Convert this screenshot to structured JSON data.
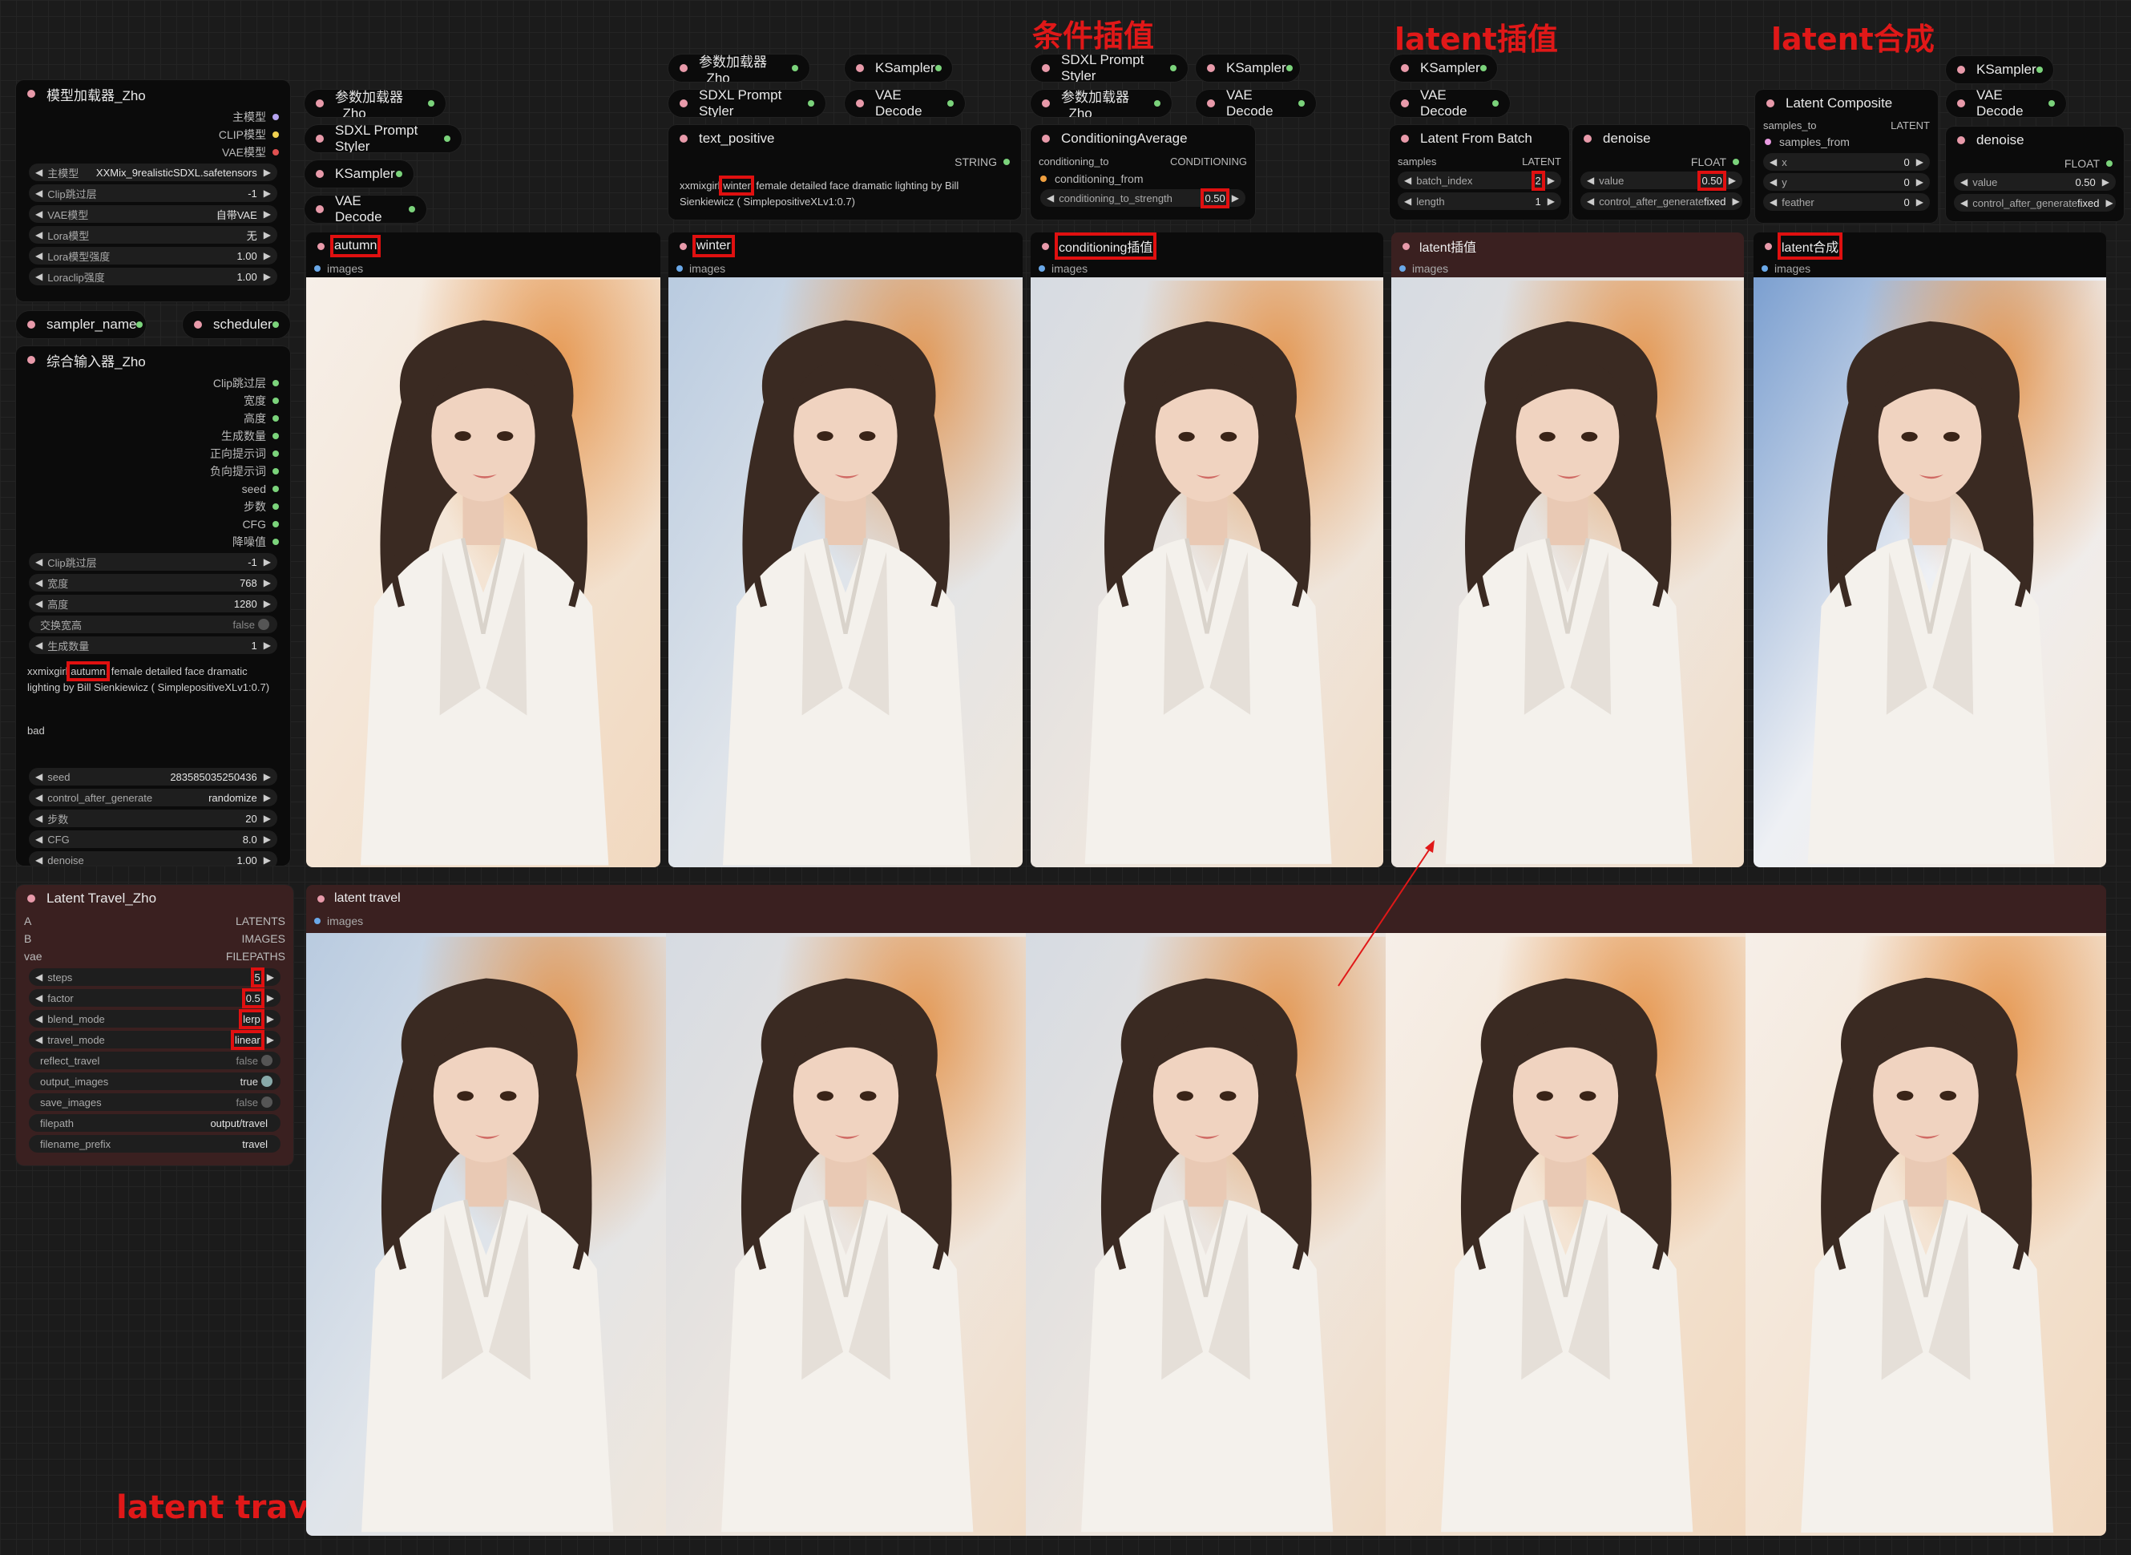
{
  "annotations": {
    "cond_interp": "条件插值",
    "latent_interp": "latent插值",
    "latent_comp": "latent合成",
    "latent_travel": "latent travel"
  },
  "colors": {
    "accent_red": "#e01818",
    "bg": "#1b1b1b",
    "node_bg": "#0b0b0b",
    "brown_node": "#3a2020"
  },
  "model_loader": {
    "title": "模型加载器_Zho",
    "outputs": [
      "主模型",
      "CLIP模型",
      "VAE模型"
    ],
    "widgets": [
      {
        "label": "主模型",
        "value": "XXMix_9realisticSDXL.safetensors"
      },
      {
        "label": "Clip跳过层",
        "value": "-1"
      },
      {
        "label": "VAE模型",
        "value": "自带VAE"
      },
      {
        "label": "Lora模型",
        "value": "无"
      },
      {
        "label": "Lora模型强度",
        "value": "1.00"
      },
      {
        "label": "Loraclip强度",
        "value": "1.00"
      }
    ]
  },
  "sampler_name": "sampler_name",
  "scheduler": "scheduler",
  "combo_input": {
    "title": "综合输入器_Zho",
    "outputs": [
      "Clip跳过层",
      "宽度",
      "高度",
      "生成数量",
      "正向提示词",
      "负向提示词",
      "seed",
      "步数",
      "CFG",
      "降噪值"
    ],
    "widgets": [
      {
        "label": "Clip跳过层",
        "value": "-1"
      },
      {
        "label": "宽度",
        "value": "768"
      },
      {
        "label": "高度",
        "value": "1280"
      },
      {
        "label": "交换宽高",
        "value": "false"
      },
      {
        "label": "生成数量",
        "value": "1"
      }
    ],
    "prompt_pre": "xxmixgirl",
    "prompt_key": "autumn",
    "prompt_post": ", female detailed face dramatic lighting by Bill Sienkiewicz ( SimplepositiveXLv1:0.7)",
    "negative": "bad",
    "widgets2": [
      {
        "label": "seed",
        "value": "283585035250436"
      },
      {
        "label": "control_after_generate",
        "value": "randomize"
      },
      {
        "label": "步数",
        "value": "20"
      },
      {
        "label": "CFG",
        "value": "8.0"
      },
      {
        "label": "denoise",
        "value": "1.00"
      }
    ]
  },
  "latent_travel_node": {
    "title": "Latent Travel_Zho",
    "inputs": [
      "A",
      "B",
      "vae"
    ],
    "outputs": [
      "LATENTS",
      "IMAGES",
      "FILEPATHS"
    ],
    "widgets": [
      {
        "label": "steps",
        "value": "5"
      },
      {
        "label": "factor",
        "value": "0.5"
      },
      {
        "label": "blend_mode",
        "value": "lerp"
      },
      {
        "label": "travel_mode",
        "value": "linear"
      },
      {
        "label": "reflect_travel",
        "value": "false"
      },
      {
        "label": "output_images",
        "value": "true"
      },
      {
        "label": "save_images",
        "value": "false"
      },
      {
        "label": "filepath",
        "value": "output/travel"
      },
      {
        "label": "filename_prefix",
        "value": "travel"
      }
    ]
  },
  "col1": {
    "param_loader": "参数加载器_Zho",
    "styler": "SDXL Prompt Styler",
    "ksampler": "KSampler",
    "vae_decode": "VAE Decode"
  },
  "col2": {
    "param_loader": "参数加载器_Zho",
    "styler": "SDXL Prompt Styler",
    "ksampler": "KSampler",
    "vae_decode": "VAE Decode",
    "text_positive": {
      "title": "text_positive",
      "out": "STRING",
      "pre": "xxmixgirl",
      "key": "winter",
      "post": ", female detailed face dramatic lighting by Bill Sienkiewicz ( SimplepositiveXLv1:0.7)"
    }
  },
  "col3": {
    "styler": "SDXL Prompt Styler",
    "ksampler": "KSampler",
    "param_loader": "参数加载器_Zho",
    "vae_decode": "VAE Decode",
    "cond_avg": {
      "title": "ConditioningAverage",
      "in1": "conditioning_to",
      "in2": "conditioning_from",
      "out": "CONDITIONING",
      "w_label": "conditioning_to_strength",
      "w_value": "0.50"
    }
  },
  "col4": {
    "ksampler": "KSampler",
    "vae_decode": "VAE Decode",
    "latent_batch": {
      "title": "Latent From Batch",
      "in": "samples",
      "out": "LATENT",
      "w1_label": "batch_index",
      "w1_value": "2",
      "w2_label": "length",
      "w2_value": "1"
    },
    "denoise": {
      "title": "denoise",
      "out": "FLOAT",
      "w1_label": "value",
      "w1_value": "0.50",
      "w2_label": "control_after_generate",
      "w2_value": "fixed"
    }
  },
  "col5": {
    "ksampler": "KSampler",
    "vae_decode": "VAE Decode",
    "latent_comp": {
      "title": "Latent Composite",
      "in1": "samples_to",
      "in2": "samples_from",
      "out": "LATENT",
      "widgets": [
        {
          "label": "x",
          "value": "0"
        },
        {
          "label": "y",
          "value": "0"
        },
        {
          "label": "feather",
          "value": "0"
        }
      ]
    },
    "denoise": {
      "title": "denoise",
      "out": "FLOAT",
      "w1_label": "value",
      "w1_value": "0.50",
      "w2_label": "control_after_generate",
      "w2_value": "fixed"
    }
  },
  "panels": [
    {
      "title": "autumn",
      "sub": "images"
    },
    {
      "title": "winter",
      "sub": "images"
    },
    {
      "title": "conditioning插值",
      "sub": "images"
    },
    {
      "title": "latent插值",
      "sub": "images"
    },
    {
      "title": "latent合成",
      "sub": "images"
    }
  ],
  "travel_panel": {
    "title": "latent travel",
    "sub": "images"
  }
}
